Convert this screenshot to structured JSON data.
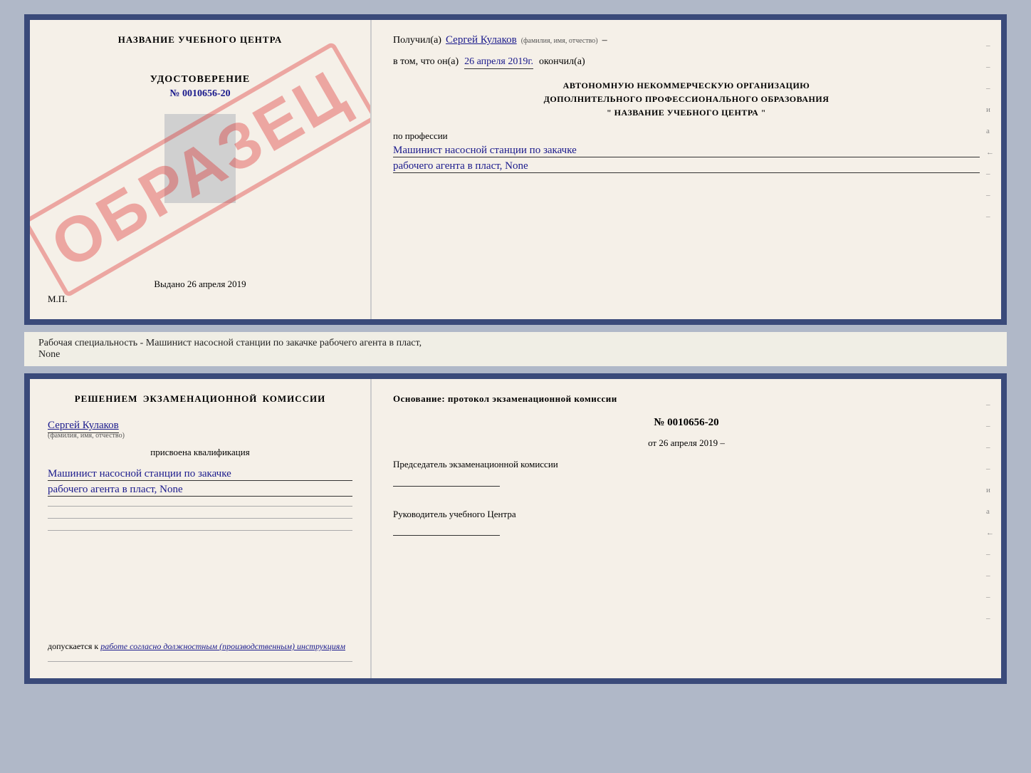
{
  "topDoc": {
    "left": {
      "title": "НАЗВАНИЕ УЧЕБНОГО ЦЕНТРА",
      "udTitle": "УДОСТОВЕРЕНИЕ",
      "udNumber": "№ 0010656-20",
      "vydano": "Выдано 26 апреля 2019",
      "mp": "М.П.",
      "obrazets": "ОБРАЗЕЦ"
    },
    "right": {
      "poluchil": "Получил(а)",
      "name": "Сергей Кулаков",
      "nameHint": "(фамилия, имя, отчество)",
      "dash": "–",
      "vtom": "в том, что он(а)",
      "date": "26 апреля 2019г.",
      "okonchil": "окончил(а)",
      "orgLine1": "АВТОНОМНУЮ НЕКОММЕРЧЕСКУЮ ОРГАНИЗАЦИЮ",
      "orgLine2": "ДОПОЛНИТЕЛЬНОГО ПРОФЕССИОНАЛЬНОГО ОБРАЗОВАНИЯ",
      "orgLine3": "\"   НАЗВАНИЕ УЧЕБНОГО ЦЕНТРА   \"",
      "poProfessii": "по профессии",
      "profession1": "Машинист насосной станции по закачке",
      "profession2": "рабочего агента в пласт, None",
      "sideLines": [
        "–",
        "–",
        "–",
        "и",
        "а",
        "←",
        "–",
        "–",
        "–"
      ]
    }
  },
  "middleText": "Рабочая специальность - Машинист насосной станции по закачке рабочего агента в пласт,",
  "middleText2": "None",
  "bottomDoc": {
    "left": {
      "resheniemTitle": "Решением  экзаменационной  комиссии",
      "name": "Сергей Кулаков",
      "nameHint": "(фамилия, имя, отчество)",
      "prisvoena": "присвоена квалификация",
      "profession1": "Машинист насосной станции по закачке",
      "profession2": "рабочего агента в пласт, None",
      "dopuskaetsya": "допускается к",
      "dopuskaetsyaText": "работе согласно должностным (производственным) инструкциям"
    },
    "right": {
      "osnovanie": "Основание: протокол экзаменационной  комиссии",
      "number": "№  0010656-20",
      "ot": "от",
      "date": "26 апреля 2019",
      "predsedatelTitle": "Председатель экзаменационной комиссии",
      "rukovoditelTitle": "Руководитель учебного Центра",
      "sideLines": [
        "–",
        "–",
        "–",
        "–",
        "и",
        "а",
        "←",
        "–",
        "–",
        "–",
        "–"
      ]
    }
  }
}
